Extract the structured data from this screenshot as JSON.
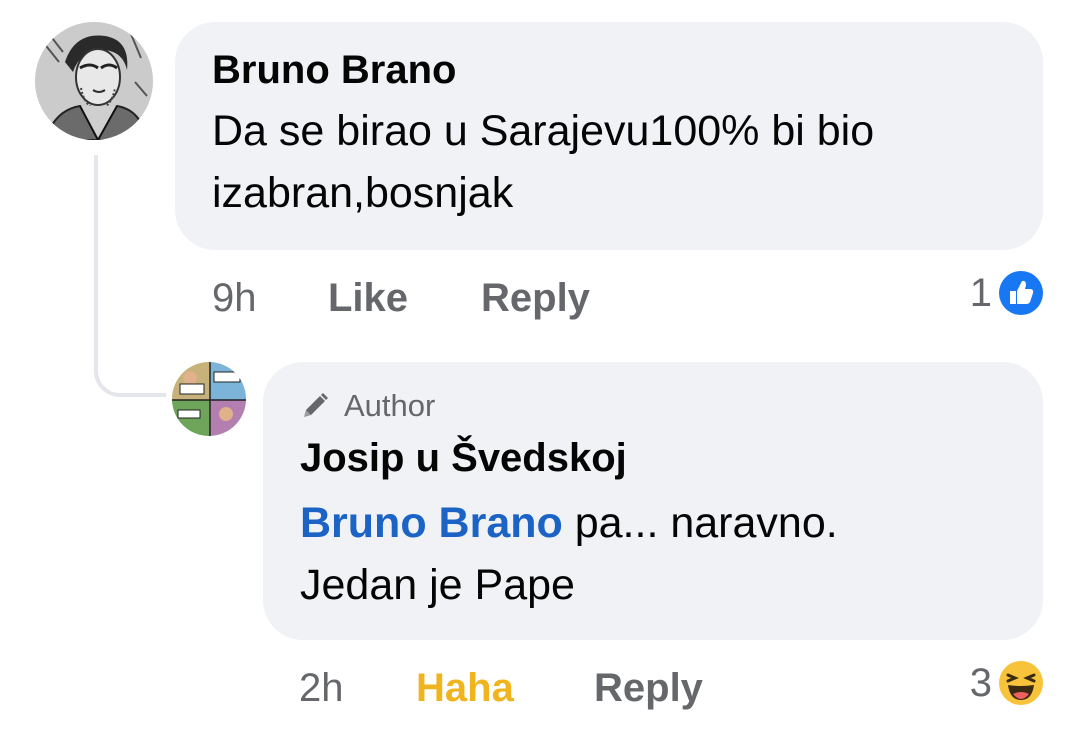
{
  "comments": [
    {
      "author": "Bruno Brano",
      "text": "Da se birao u Sarajevu100% bi bio izabran,bosnjak",
      "time": "9h",
      "like_label": "Like",
      "reply_label": "Reply",
      "reaction_count": "1",
      "reaction_icon": "like-icon",
      "avatar_icon": "sketch-portrait-avatar"
    },
    {
      "badge": "Author",
      "badge_icon": "pencil-icon",
      "author": "Josip u Švedskoj",
      "mention": "Bruno Brano",
      "text_line1": " pa... naravno.",
      "text_line2": "Jedan je Pape",
      "time": "2h",
      "reaction_label": "Haha",
      "reply_label": "Reply",
      "reaction_count": "3",
      "reaction_icon": "haha-icon",
      "avatar_icon": "comic-collage-avatar"
    }
  ],
  "colors": {
    "bubble": "#f0f2f5",
    "secondary_text": "#65676b",
    "mention": "#1b63c4",
    "haha_active": "#f0b51e",
    "like_blue": "#1877f2"
  }
}
